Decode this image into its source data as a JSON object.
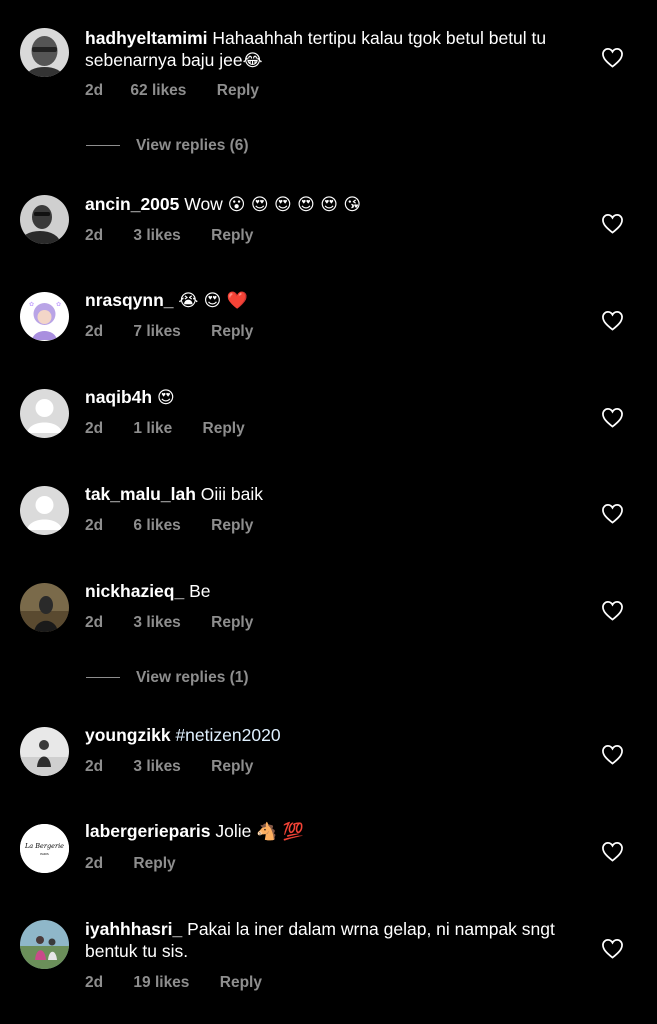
{
  "comments": [
    {
      "username": "hadhyeltamimi",
      "text": "Hahaahhah tertipu kalau tgok betul betul tu sebenarnya baju jee",
      "emoji": "😂",
      "time": "2d",
      "likes": "62 likes",
      "reply": "Reply"
    },
    {
      "username": "ancin_2005",
      "text": "Wow",
      "emoji": "😮 😍 😍 😍 😍 😘",
      "time": "2d",
      "likes": "3 likes",
      "reply": "Reply"
    },
    {
      "username": "nrasqynn_",
      "text": "",
      "emoji": "😭 😍 ❤️",
      "time": "2d",
      "likes": "7 likes",
      "reply": "Reply"
    },
    {
      "username": "naqib4h",
      "text": "",
      "emoji": "😍",
      "time": "2d",
      "likes": "1 like",
      "reply": "Reply"
    },
    {
      "username": "tak_malu_lah",
      "text": "Oiii baik",
      "emoji": "",
      "time": "2d",
      "likes": "6 likes",
      "reply": "Reply"
    },
    {
      "username": "nickhazieq_",
      "text": "Be",
      "emoji": "",
      "time": "2d",
      "likes": "3 likes",
      "reply": "Reply"
    },
    {
      "username": "youngzikk",
      "text": "#netizen2020",
      "emoji": "",
      "time": "2d",
      "likes": "3 likes",
      "reply": "Reply"
    },
    {
      "username": "labergerieparis",
      "text": "Jolie",
      "emoji": "🐴 💯",
      "time": "2d",
      "likes": "",
      "reply": "Reply",
      "avatar_text": "La Bergerie",
      "avatar_sub": "PARIS"
    },
    {
      "username": "iyahhhasri_",
      "text": "Pakai la iner dalam wrna gelap, ni nampak sngt bentuk tu sis.",
      "emoji": "",
      "time": "2d",
      "likes": "19 likes",
      "reply": "Reply"
    }
  ],
  "view_replies": [
    "View replies (6)",
    "View replies (1)"
  ],
  "icons": {
    "like": "heart-outline-icon"
  },
  "colors": {
    "background": "#000000",
    "text": "#ffffff",
    "meta": "#8e8e8e"
  }
}
